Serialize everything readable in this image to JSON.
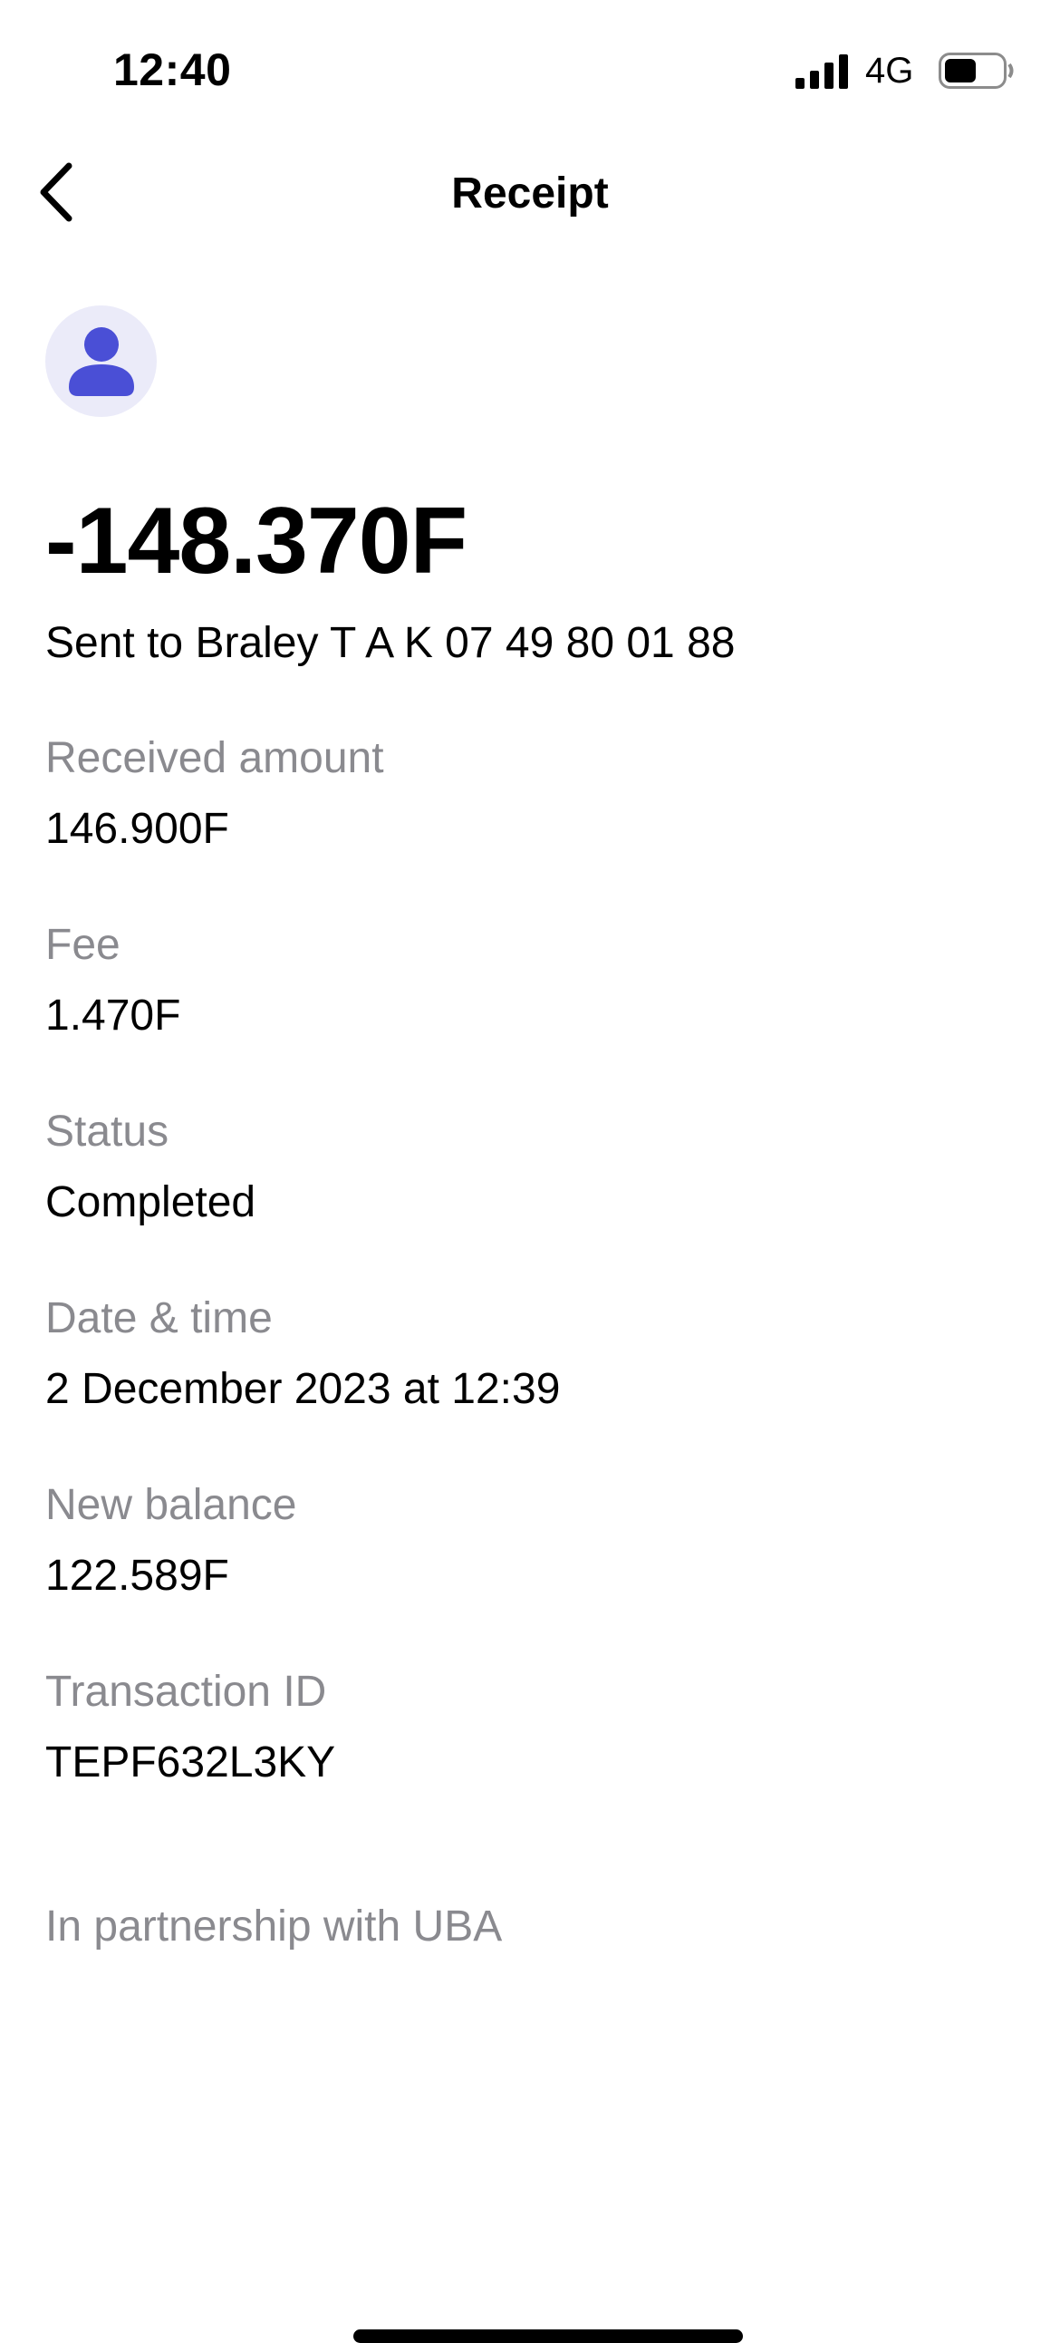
{
  "status_bar": {
    "time": "12:40",
    "network": "4G",
    "signal_icon": "cellular-signal-icon",
    "battery_icon": "battery-icon",
    "battery_level": 0.55
  },
  "nav": {
    "title": "Receipt",
    "back_icon": "chevron-left-icon"
  },
  "receipt": {
    "avatar_icon": "person-icon",
    "avatar_color": "#4a4fd6",
    "amount": "-148.370F",
    "recipient": "Sent to Braley T A K 07 49 80 01 88",
    "fields": [
      {
        "label": "Received amount",
        "value": "146.900F"
      },
      {
        "label": "Fee",
        "value": "1.470F"
      },
      {
        "label": "Status",
        "value": "Completed"
      },
      {
        "label": "Date & time",
        "value": "2 December 2023 at 12:39"
      },
      {
        "label": "New balance",
        "value": "122.589F"
      },
      {
        "label": "Transaction ID",
        "value": "TEPF632L3KY"
      }
    ],
    "partnership": "In partnership with UBA"
  }
}
